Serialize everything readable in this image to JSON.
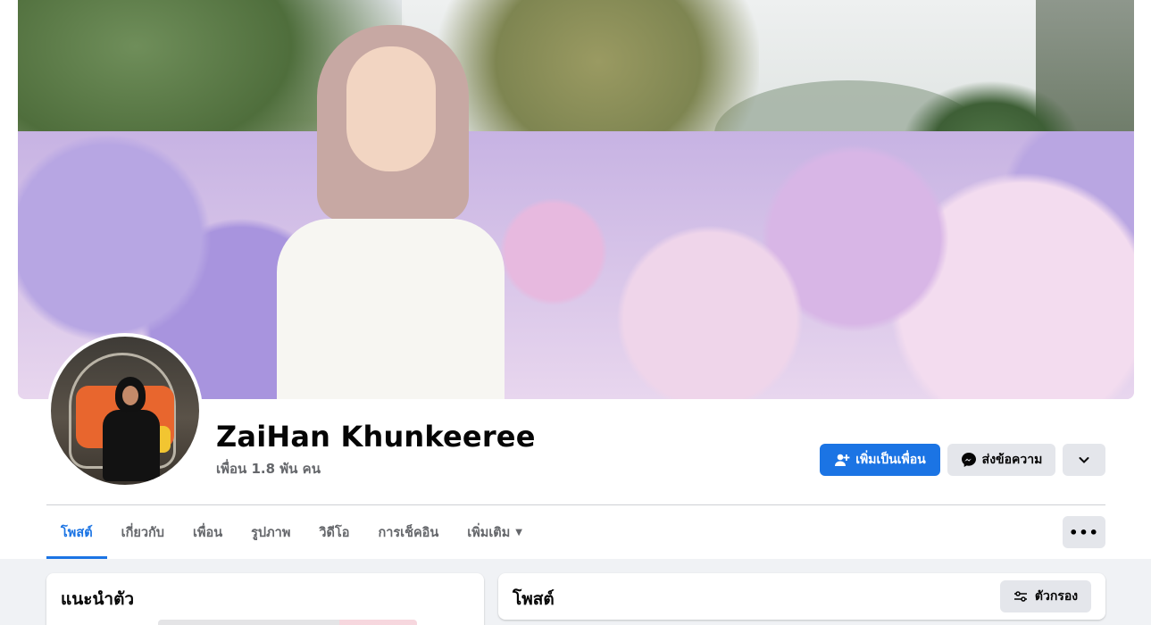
{
  "profile": {
    "name": "ZaiHan Khunkeeree",
    "friends_count": "เพื่อน 1.8 พัน คน"
  },
  "actions": {
    "add_friend": "เพิ่มเป็นเพื่อน",
    "message": "ส่งข้อความ"
  },
  "tabs": [
    {
      "label": "โพสต์",
      "active": true
    },
    {
      "label": "เกี่ยวกับ"
    },
    {
      "label": "เพื่อน"
    },
    {
      "label": "รูปภาพ"
    },
    {
      "label": "วิดีโอ"
    },
    {
      "label": "การเช็คอิน"
    },
    {
      "label": "เพิ่มเติม"
    }
  ],
  "intro": {
    "title": "แนะนำตัว"
  },
  "posts": {
    "title": "โพสต์",
    "filter_label": "ตัวกรอง"
  },
  "colors": {
    "accent": "#1b74e4",
    "secondary_button": "#e4e6eb",
    "feed_background": "#f0f2f5"
  }
}
